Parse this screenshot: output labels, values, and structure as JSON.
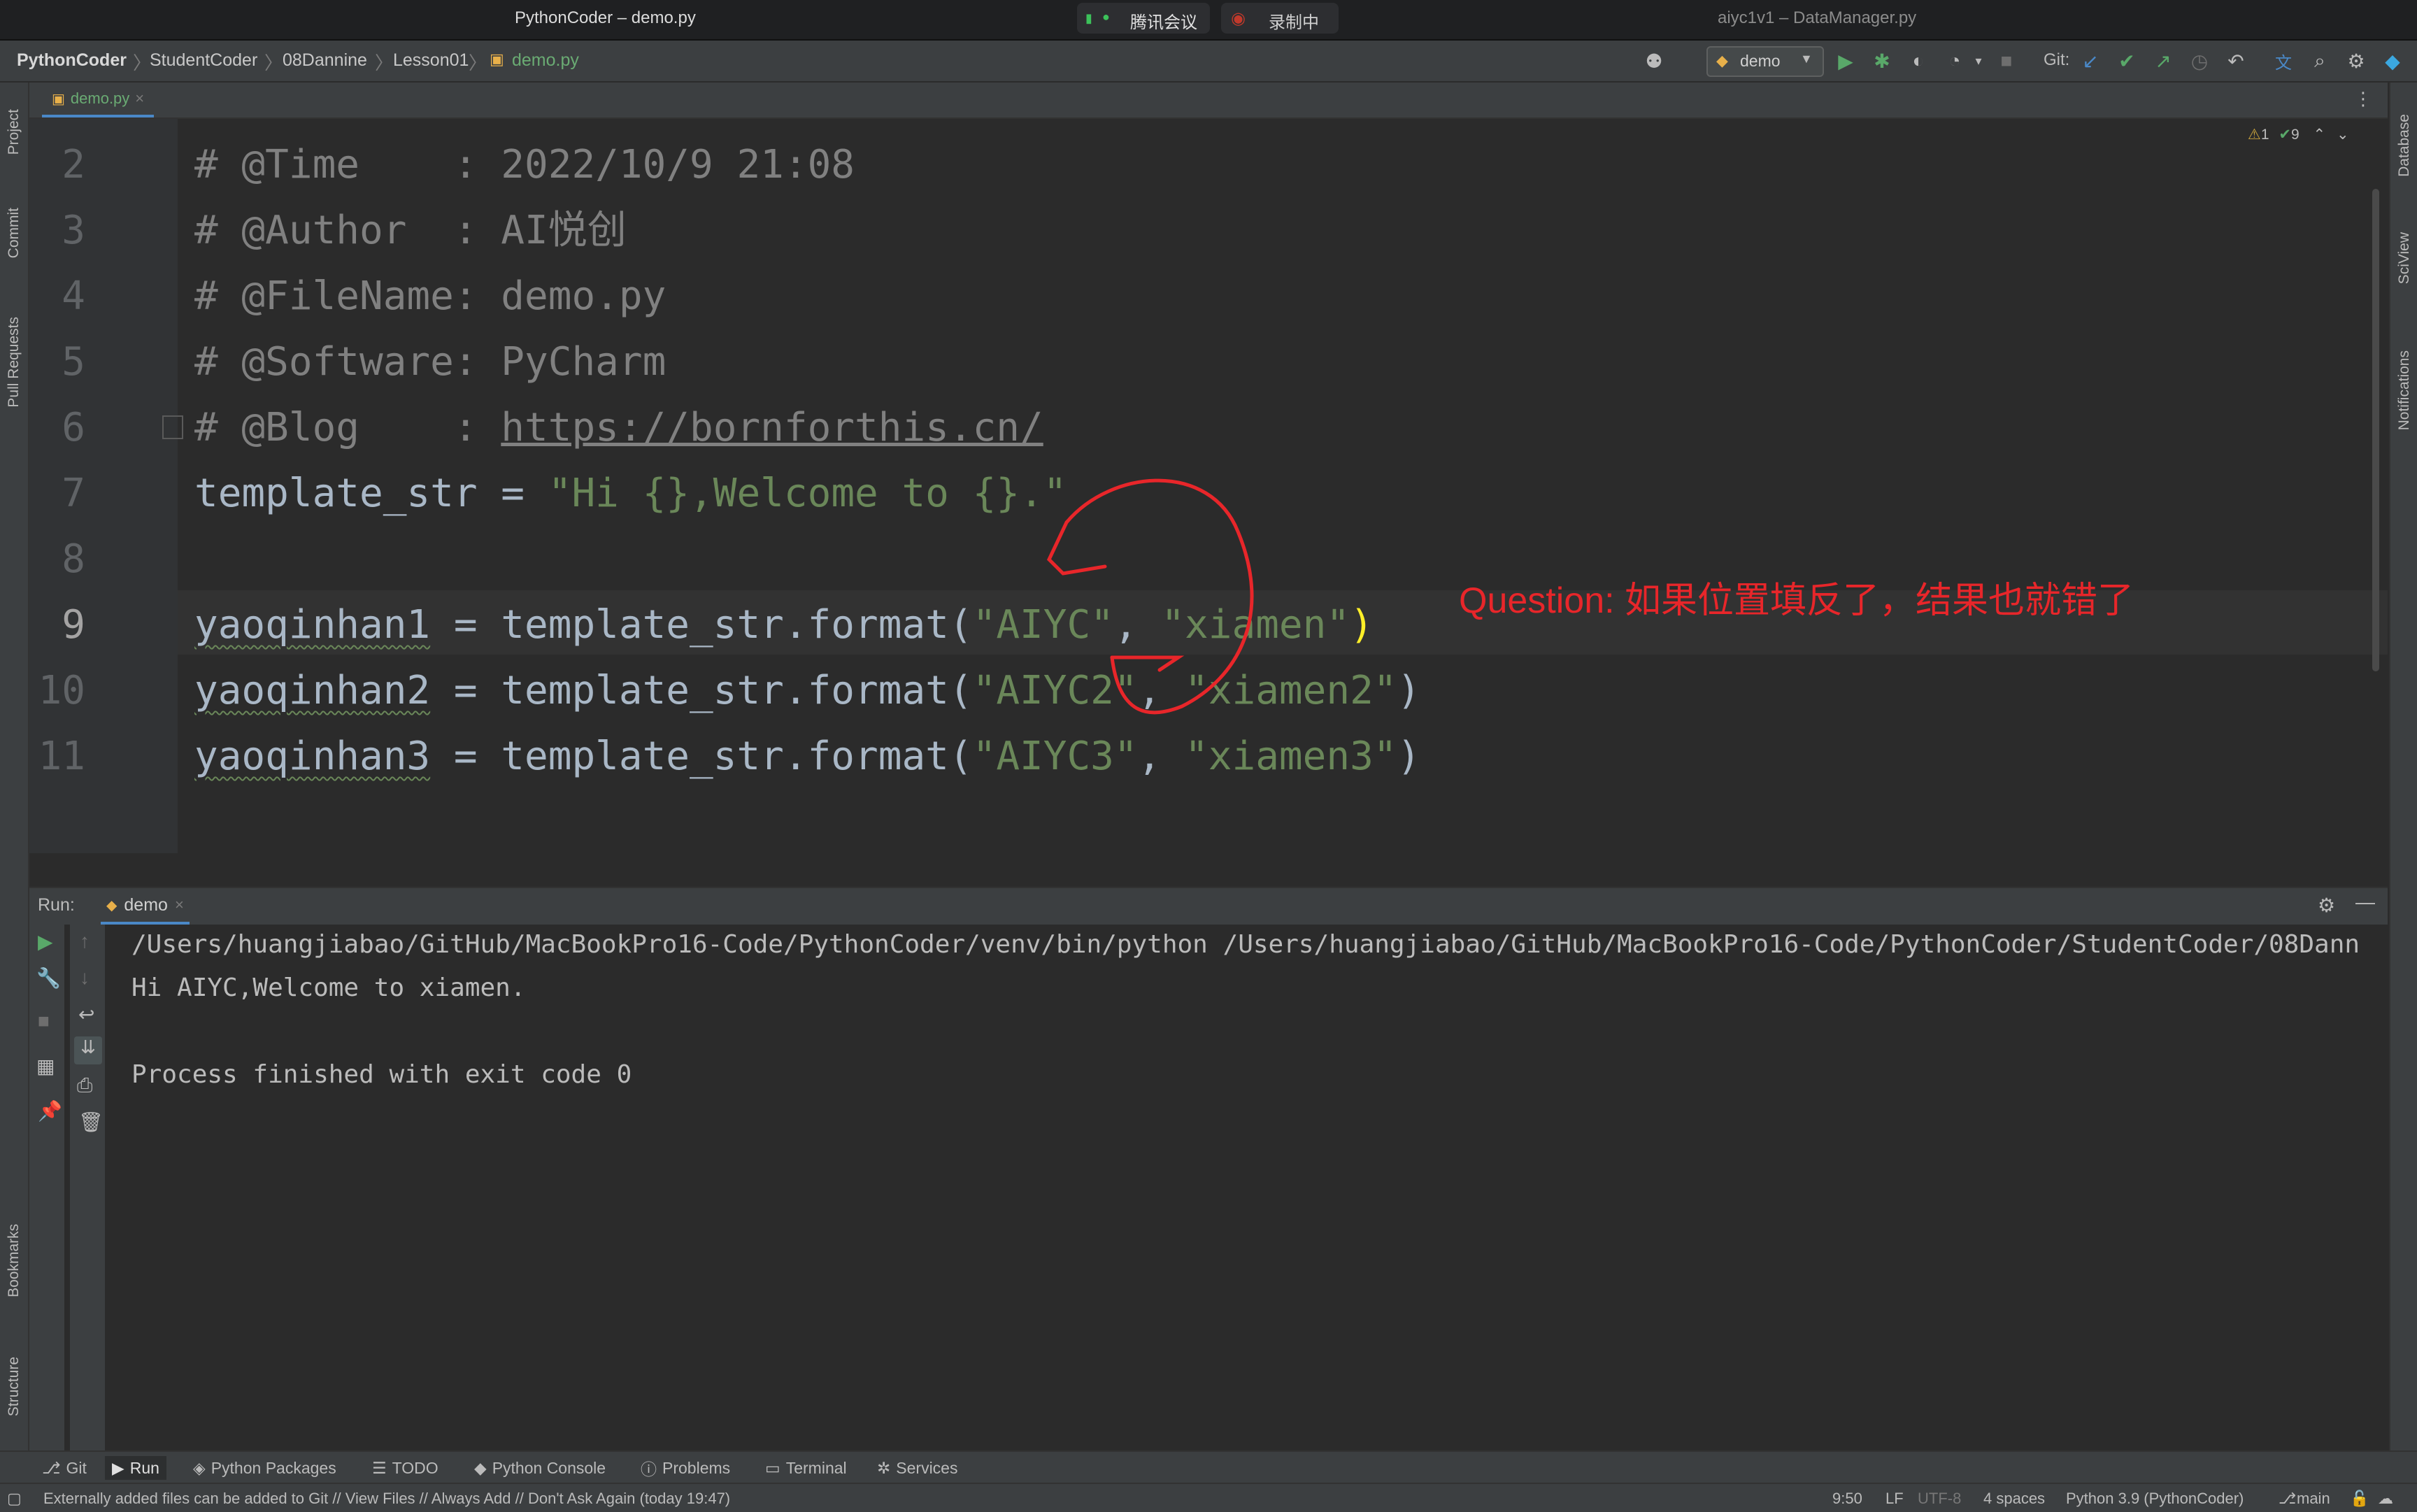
{
  "window": {
    "title": "PythonCoder – demo.py",
    "other_window_title": "aiyc1v1 – DataManager.py",
    "meeting_app": "腾讯会议",
    "recording_label": "录制中"
  },
  "breadcrumb": [
    "PythonCoder",
    "StudentCoder",
    "08Dannine",
    "Lesson01",
    "demo.py"
  ],
  "toolbar": {
    "run_config": "demo",
    "git_label": "Git:"
  },
  "left_strip": [
    "Project",
    "Commit",
    "Pull Requests",
    "Bookmarks",
    "Structure"
  ],
  "right_strip": [
    "Database",
    "SciView",
    "Notifications"
  ],
  "editor": {
    "tab": "demo.py",
    "inspection": {
      "warnings": "1",
      "ok": "9"
    },
    "lines": [
      {
        "n": "2",
        "text": "# @Time    : 2022/10/9 21:08"
      },
      {
        "n": "3",
        "text": "# @Author  : AI悦创"
      },
      {
        "n": "4",
        "text": "# @FileName: demo.py"
      },
      {
        "n": "5",
        "text": "# @Software: PyCharm"
      },
      {
        "n": "6",
        "text_prefix": "# @Blog    : ",
        "url": "https://bornforthis.cn/"
      },
      {
        "n": "7",
        "code": "template_str = ",
        "string": "\"Hi {},Welcome to {}.\""
      },
      {
        "n": "8"
      },
      {
        "n": "9",
        "var": "yaoqinhan1",
        "mid": " = template_str.format(",
        "s1": "\"AIYC\"",
        "comma": ", ",
        "s2": "\"xiamen\"",
        "close": ")"
      },
      {
        "n": "10",
        "var": "yaoqinhan2",
        "mid": " = template_str.format(",
        "s1": "\"AIYC2\"",
        "comma": ", ",
        "s2": "\"xiamen2\"",
        "close": ")"
      },
      {
        "n": "11",
        "var": "yaoqinhan3",
        "mid": " = template_str.format(",
        "s1": "\"AIYC3\"",
        "comma": ", ",
        "s2": "\"xiamen3\"",
        "close": ")"
      }
    ],
    "annotation": "Question: 如果位置填反了，结果也就错了"
  },
  "run": {
    "label": "Run:",
    "tab": "demo",
    "output": [
      "/Users/huangjiabao/GitHub/MacBookPro16-Code/PythonCoder/venv/bin/python /Users/huangjiabao/GitHub/MacBookPro16-Code/PythonCoder/StudentCoder/08Dann",
      "Hi AIYC,Welcome to xiamen.",
      "",
      "Process finished with exit code 0"
    ]
  },
  "bottom_tabs": [
    "Git",
    "Run",
    "Python Packages",
    "TODO",
    "Python Console",
    "Problems",
    "Terminal",
    "Services"
  ],
  "status": {
    "message": "Externally added files can be added to Git // View Files // Always Add // Don't Ask Again (today 19:47)",
    "position": "9:50",
    "line_sep": "LF",
    "encoding": "UTF-8",
    "indent": "4 spaces",
    "interpreter": "Python 3.9 (PythonCoder)",
    "branch": "main"
  },
  "colors": {
    "annotation": "#e8262a",
    "string": "#6a8759",
    "comment": "#808080",
    "run_green": "#59a869"
  }
}
